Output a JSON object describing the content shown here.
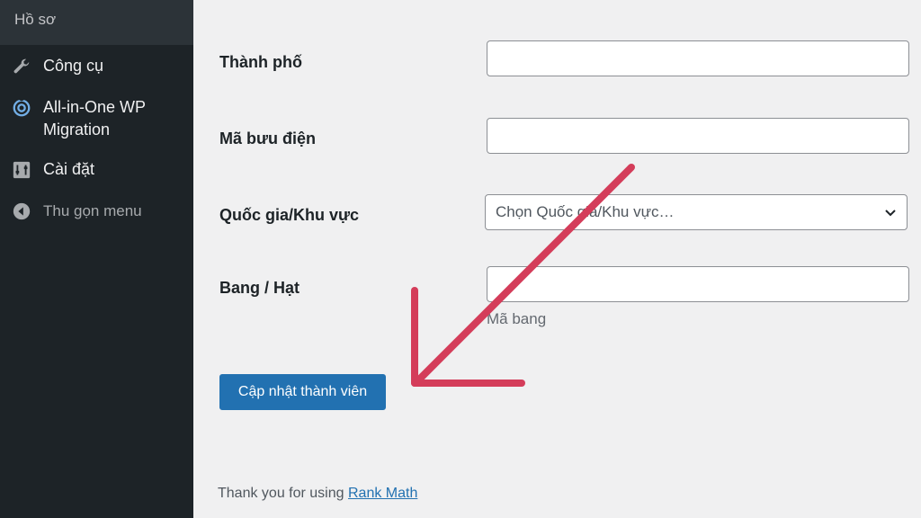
{
  "sidebar": {
    "profile": "Hồ sơ",
    "items": [
      {
        "label": "Công cụ",
        "icon": "wrench-icon"
      },
      {
        "label": "All-in-One WP Migration",
        "icon": "migration-icon"
      },
      {
        "label": "Cài đặt",
        "icon": "settings-icon"
      },
      {
        "label": "Thu gọn menu",
        "icon": "collapse-icon"
      }
    ]
  },
  "form": {
    "city_label": "Thành phố",
    "city_value": "",
    "postcode_label": "Mã bưu điện",
    "postcode_value": "",
    "country_label": "Quốc gia/Khu vực",
    "country_selected": "Chọn Quốc gia/Khu vực…",
    "state_label": "Bang / Hạt",
    "state_value": "",
    "state_hint": "Mã bang",
    "submit_label": "Cập nhật thành viên"
  },
  "footer": {
    "text": "Thank you for using",
    "link": "Rank Math"
  },
  "colors": {
    "sidebar_bg": "#1d2327",
    "accent": "#2271b1",
    "annotation_arrow": "#d43d5a"
  }
}
